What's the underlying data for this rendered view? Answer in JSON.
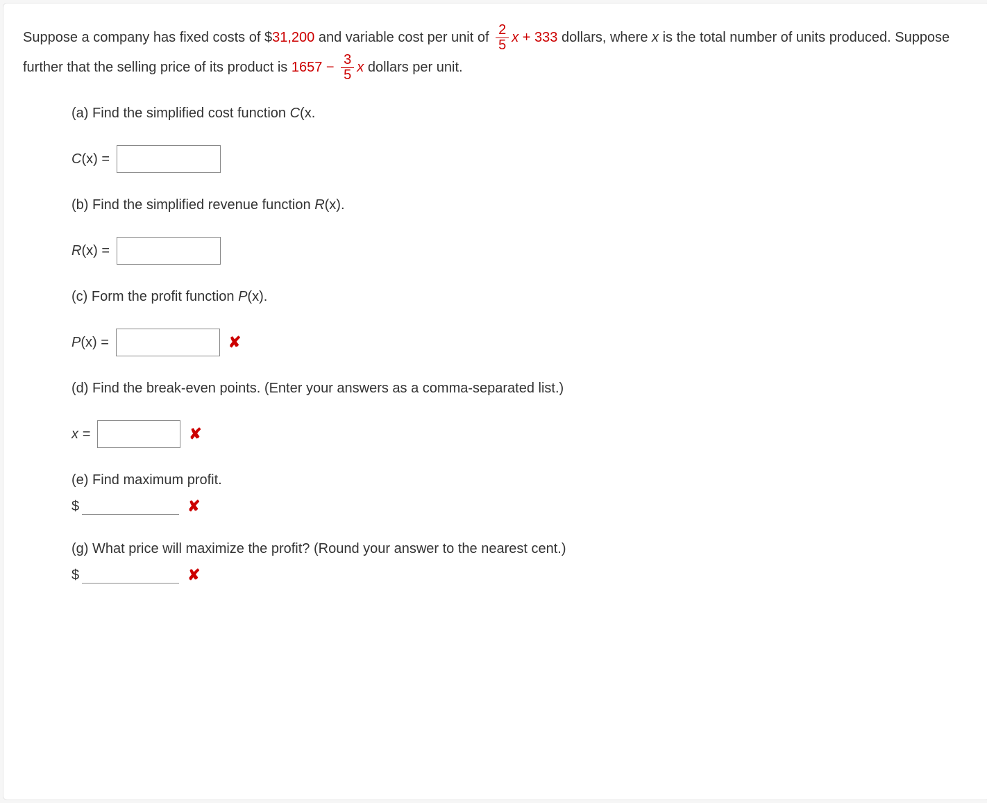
{
  "intro": {
    "prefix": "Suppose a company has fixed costs of $",
    "fixed_cost": "31,200",
    "mid1": " and variable cost per unit of ",
    "vc_frac_num": "2",
    "vc_frac_den": "5",
    "vc_after_frac_1": "x",
    "vc_after_frac_2": " + ",
    "vc_const": "333",
    "mid2": " dollars, where ",
    "var_x": "x",
    "mid3": " is the total number of units produced. Suppose further that the selling price of its product is ",
    "sp_const": "1657",
    "sp_minus": " − ",
    "sp_frac_num": "3",
    "sp_frac_den": "5",
    "sp_after_frac": "x",
    "tail": " dollars per unit."
  },
  "parts": {
    "a": {
      "prompt_prefix": "(a) Find the simplified cost function ",
      "prompt_fn": "C",
      "prompt_suffix": "(x.",
      "label_fn": "C",
      "label_suffix": "(x) ="
    },
    "b": {
      "prompt_prefix": "(b) Find the simplified revenue function ",
      "prompt_fn": "R",
      "prompt_suffix": "(x).",
      "label_fn": "R",
      "label_suffix": "(x) ="
    },
    "c": {
      "prompt_prefix": "(c) Form the profit function ",
      "prompt_fn": "P",
      "prompt_suffix": "(x).",
      "label_fn": "P",
      "label_suffix": "(x) ="
    },
    "d": {
      "prompt": "(d) Find the break-even points. (Enter your answers as a comma-separated list.)",
      "label": "x ="
    },
    "e": {
      "prompt": "(e) Find maximum profit.",
      "dollar": "$"
    },
    "g": {
      "prompt": "(g) What price will maximize the profit? (Round your answer to the nearest cent.)",
      "dollar": "$"
    }
  },
  "icons": {
    "wrong": "✘"
  }
}
